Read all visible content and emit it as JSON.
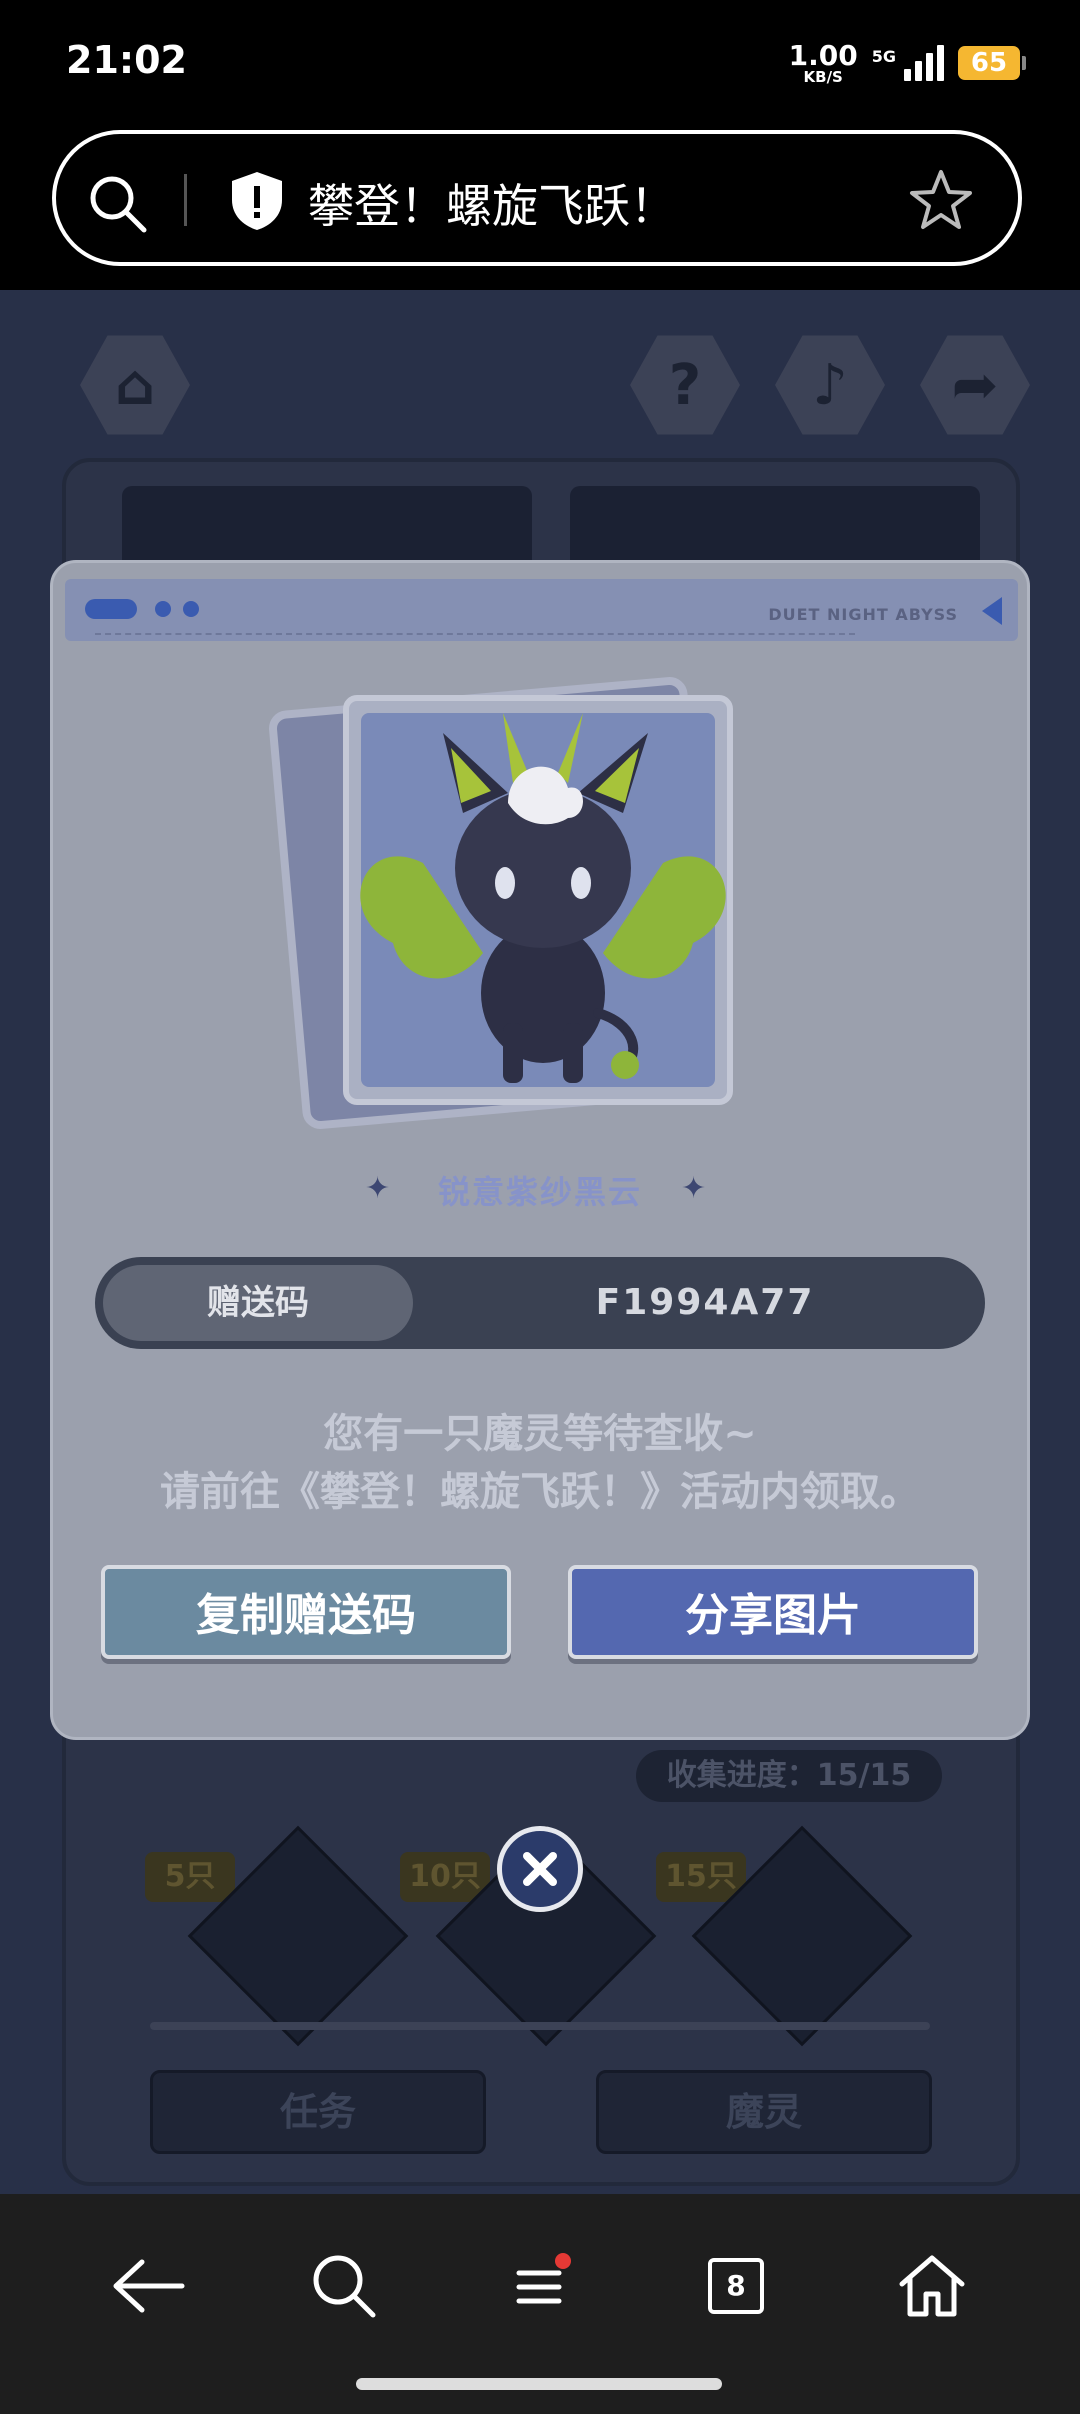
{
  "status_bar": {
    "time": "21:02",
    "net_speed_value": "1.00",
    "net_speed_unit": "KB/S",
    "network": "5G",
    "battery": "65"
  },
  "browser": {
    "url_title": "攀登！螺旋飞跃！",
    "icons": [
      "search-icon",
      "shield-icon",
      "star-icon"
    ]
  },
  "game_background": {
    "progress_text": "收集进度：15/15",
    "milestones": [
      "5只",
      "10只",
      "15只"
    ],
    "bottom_buttons": [
      "任务",
      "魔灵"
    ]
  },
  "modal": {
    "brand": "DUET NIGHT ABYSS",
    "pet_name": "锐意紫纱黑云",
    "gift_code_label": "赠送码",
    "gift_code_value": "F1994A77",
    "message_line1": "您有一只魔灵等待查收~",
    "message_line2": "请前往《攀登！螺旋飞跃！》活动内领取。",
    "copy_button": "复制赠送码",
    "share_button": "分享图片"
  },
  "navbar": {
    "tab_count": "8",
    "has_menu_notification": true,
    "icons": [
      "back-icon",
      "search-icon",
      "menu-icon",
      "tabs-icon",
      "home-icon"
    ]
  }
}
